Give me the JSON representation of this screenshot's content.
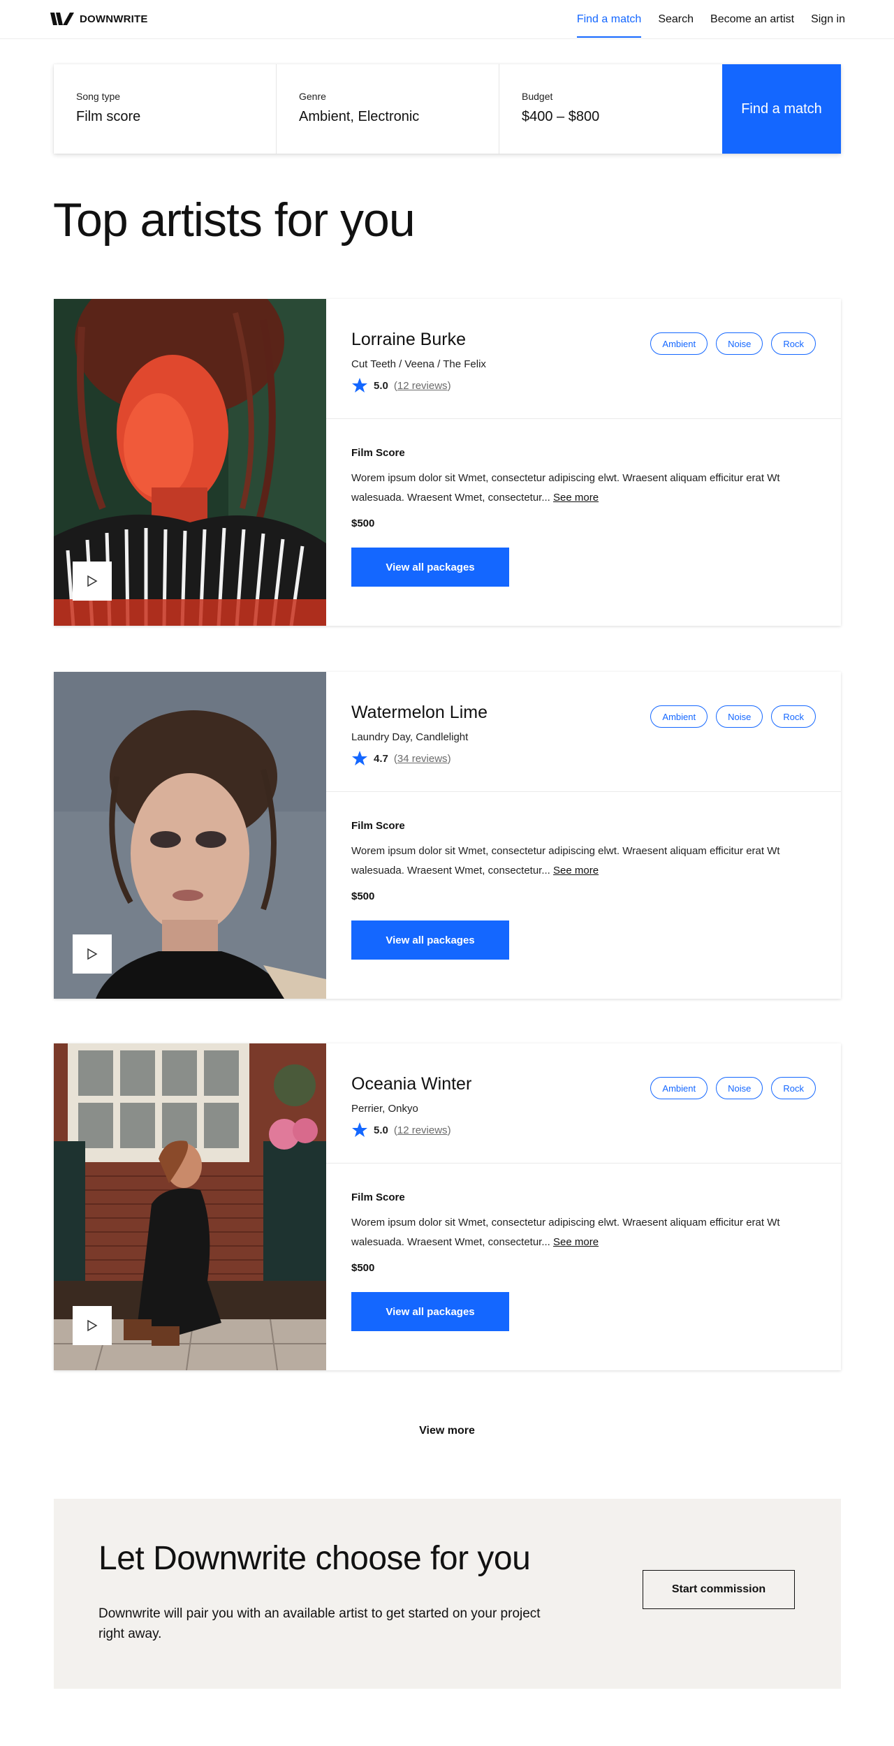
{
  "header": {
    "logo_text": "DOWNWRITE",
    "nav": [
      {
        "label": "Find a match",
        "active": true
      },
      {
        "label": "Search",
        "active": false
      },
      {
        "label": "Become an artist",
        "active": false
      },
      {
        "label": "Sign in",
        "active": false
      }
    ]
  },
  "search": {
    "fields": [
      {
        "label": "Song type",
        "value": "Film score"
      },
      {
        "label": "Genre",
        "value": "Ambient, Electronic"
      },
      {
        "label": "Budget",
        "value": "$400 – $800"
      }
    ],
    "button_label": "Find a match"
  },
  "page_title": "Top artists for you",
  "artists": [
    {
      "name": "Lorraine Burke",
      "credits": "Cut Teeth / Veena / The Felix",
      "rating": "5.0",
      "reviews": "12 reviews",
      "tags": [
        "Ambient",
        "Noise",
        "Rock"
      ],
      "package_title": "Film Score",
      "package_desc": "Worem ipsum dolor sit Wmet, consectetur adipiscing elwt. Wraesent aliquam efficitur erat Wt walesuada. Wraesent Wmet, consectetur...",
      "see_more": "See more",
      "price": "$500",
      "button_label": "View all packages"
    },
    {
      "name": "Watermelon Lime",
      "credits": "Laundry Day, Candlelight",
      "rating": "4.7",
      "reviews": "34 reviews",
      "tags": [
        "Ambient",
        "Noise",
        "Rock"
      ],
      "package_title": "Film Score",
      "package_desc": "Worem ipsum dolor sit Wmet, consectetur adipiscing elwt. Wraesent aliquam efficitur erat Wt walesuada. Wraesent Wmet, consectetur...",
      "see_more": "See more",
      "price": "$500",
      "button_label": "View all packages"
    },
    {
      "name": "Oceania Winter",
      "credits": "Perrier, Onkyo",
      "rating": "5.0",
      "reviews": "12 reviews",
      "tags": [
        "Ambient",
        "Noise",
        "Rock"
      ],
      "package_title": "Film Score",
      "package_desc": "Worem ipsum dolor sit Wmet, consectetur adipiscing elwt. Wraesent aliquam efficitur erat Wt walesuada. Wraesent Wmet, consectetur...",
      "see_more": "See more",
      "price": "$500",
      "button_label": "View all packages"
    }
  ],
  "view_more": "View more",
  "promo": {
    "title": "Let Downwrite choose for you",
    "text": "Downwrite will pair you with an available artist to get started on your project right away.",
    "button_label": "Start commission"
  },
  "colors": {
    "accent": "#1467ff",
    "promo_bg": "#f3f1ee"
  }
}
